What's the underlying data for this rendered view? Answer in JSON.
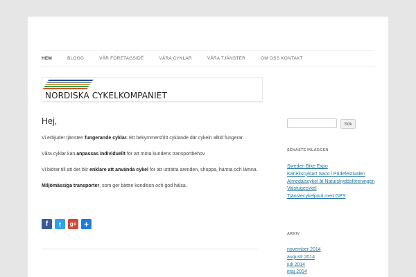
{
  "nav": {
    "items": [
      "HEM",
      "BLOGG",
      "VÅR FÖRETAGSIDÉ",
      "VÅRA CYKLAR",
      "VÅRA TJÄNSTER",
      "OM OSS KONTAKT"
    ]
  },
  "logo": {
    "text": "NORDISKA CYKELKOMPANIET",
    "stripe_colors": [
      "#1b4f9c",
      "#8d8d8d",
      "#c9a046",
      "#2e9e5b",
      "#c85a2a"
    ]
  },
  "content": {
    "greeting": "Hej,",
    "p1_a": "Vi erbjuder tjänsten ",
    "p1_b": "fungerande cyklar.",
    "p1_c": " Ett bekymmersfritt cyklande där cykeln alltid fungerar.",
    "p2_a": "Våra cyklar kan ",
    "p2_b": "anpassas individuellt",
    "p2_c": " för att möta kundens transportbehov",
    "p3_a": "Vi bidrar till att det blir ",
    "p3_b": "enklare att använda cykel",
    "p3_c": " för att utträtta ärenden, shoppa, hämta och lämna.",
    "p4_a": "Miljömässiga transporter",
    "p4_b": ", som ger bättre kondition och god hälsa."
  },
  "share": {
    "buttons": [
      {
        "icon": "facebook-icon",
        "glyph": "f",
        "color": "#3b5998"
      },
      {
        "icon": "twitter-icon",
        "glyph": "t",
        "color": "#2fa1ef"
      },
      {
        "icon": "google-plus-icon",
        "glyph": "g+",
        "color": "#d34836"
      },
      {
        "icon": "share-plus-icon",
        "glyph": "+",
        "color": "#1e7bd8"
      }
    ]
  },
  "sidebar": {
    "search_button": "Sök",
    "recent_title": "SENASTE INLÄGGEN",
    "recent_posts": [
      "Sweden Bike Expo",
      "Kärlekscyklar! Saco i Pridefestivalen",
      "Almedalscykel åt Naturskyddsföreningen",
      "Valstugecykel",
      "Tjänstecykelpool med GPS"
    ],
    "archive_title": "ARKIV",
    "archive": [
      "november 2014",
      "augusti 2014",
      "juli 2014",
      "maj 2014"
    ]
  }
}
